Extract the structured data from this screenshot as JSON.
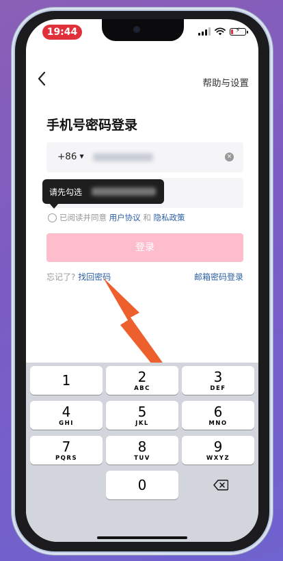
{
  "status_bar": {
    "time": "19:44",
    "signal_bars": 3,
    "battery_level": 0.15,
    "battery_color": "#e0303a"
  },
  "nav": {
    "back_icon": "chevron-left-icon",
    "help_label": "帮助与设置"
  },
  "page": {
    "title": "手机号密码登录"
  },
  "phone_field": {
    "country_code": "+86"
  },
  "tooltip": {
    "text": "请先勾选"
  },
  "agreement": {
    "prefix": "已阅读并同意",
    "user_agreement": "用户协议",
    "and": "和",
    "privacy_policy": "隐私政策"
  },
  "login_button": {
    "label": "登录",
    "color": "#fdbdcc"
  },
  "links": {
    "forgot_prefix": "忘记了?",
    "recover_password": "找回密码",
    "email_login": "邮箱密码登录"
  },
  "keyboard": {
    "keys": [
      {
        "digit": "1",
        "letters": ""
      },
      {
        "digit": "2",
        "letters": "ABC"
      },
      {
        "digit": "3",
        "letters": "DEF"
      },
      {
        "digit": "4",
        "letters": "GHI"
      },
      {
        "digit": "5",
        "letters": "JKL"
      },
      {
        "digit": "6",
        "letters": "MNO"
      },
      {
        "digit": "7",
        "letters": "PQRS"
      },
      {
        "digit": "8",
        "letters": "TUV"
      },
      {
        "digit": "9",
        "letters": "WXYZ"
      },
      {
        "digit": "0",
        "letters": ""
      }
    ],
    "delete_icon": "backspace-icon"
  },
  "annotation": {
    "arrow_color": "#ee5f2e"
  }
}
